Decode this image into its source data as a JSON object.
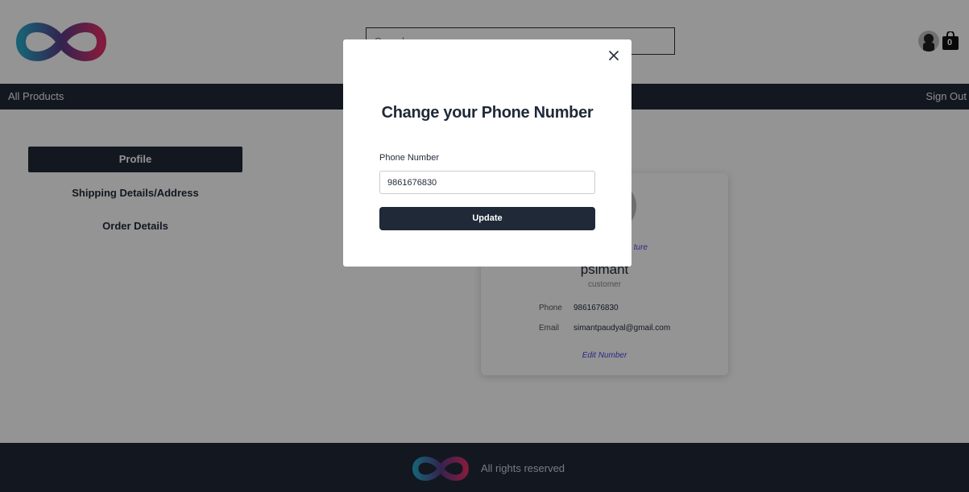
{
  "header": {
    "logo_icon": "infinity-logo-icon",
    "search_placeholder": "Search",
    "avatar_icon": "user-avatar-icon",
    "cart_icon": "shopping-bag-icon",
    "cart_count": "0"
  },
  "navbar": {
    "all_products": "All Products",
    "sign_out": "Sign Out"
  },
  "sidebar": {
    "items": [
      {
        "label": "Profile",
        "active": true
      },
      {
        "label": "Shipping Details/Address",
        "active": false
      },
      {
        "label": "Order Details",
        "active": false
      }
    ]
  },
  "profile_card": {
    "change_picture_partial": "ture",
    "name": "psimant",
    "role": "customer",
    "phone_label": "Phone",
    "phone_value": "9861676830",
    "email_label": "Email",
    "email_value": "simantpaudyal@gmail.com",
    "edit_number": "Edit Number"
  },
  "footer": {
    "logo_icon": "infinity-logo-icon",
    "text": "All rights reserved"
  },
  "modal": {
    "close_icon": "close-icon",
    "title": "Change your Phone Number",
    "phone_label": "Phone Number",
    "phone_value": "9861676830",
    "submit_label": "Update"
  },
  "colors": {
    "primary_dark": "#1f2937",
    "link": "#4f46e5",
    "overlay": "rgba(0,0,0,0.42)"
  }
}
